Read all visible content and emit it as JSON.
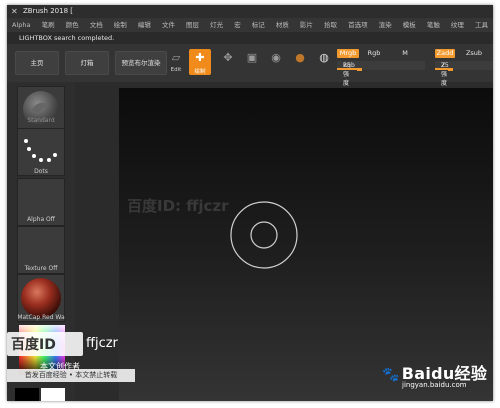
{
  "window": {
    "title": "ZBrush 2018 ["
  },
  "menu": [
    "Alpha",
    "笔刷",
    "颜色",
    "文档",
    "绘制",
    "编辑",
    "文件",
    "图层",
    "灯光",
    "宏",
    "标记",
    "材质",
    "影片",
    "拾取",
    "首选项",
    "渲染",
    "模板",
    "笔触",
    "纹理",
    "工具"
  ],
  "status": {
    "message": "LIGHTBOX search completed."
  },
  "toolbar": {
    "buttons": [
      "主页",
      "灯箱",
      "预览布尔渲染"
    ],
    "draw_label": "绘制",
    "edit_label": "Edit",
    "mrgb": "Mrgb",
    "rgb": "Rgb",
    "m": "M",
    "rgb_intensity_label": "Rgb 强度",
    "rgb_intensity_value": "25",
    "zadd": "Zadd",
    "zsub": "Zsub",
    "z_intensity_label": "Z 强度",
    "z_intensity_value": "25",
    "rgb_intensity_fraction": 0.25,
    "z_intensity_fraction": 0.25
  },
  "sidebar": {
    "materials": [
      "Standard",
      "Dots",
      "Alpha Off",
      "Texture Off",
      "MatCap Red Wa"
    ]
  },
  "watermark": {
    "top": "百度ID: ffjczr",
    "logo_text": "百度ID",
    "logo_user": "ffjczr",
    "sub": "本文创作者",
    "strip": "首发百度经验 • 本文禁止转载",
    "baidu": "Baidu经验",
    "url": "jingyan.baidu.com"
  },
  "colors": {
    "accent": "#f39a2e",
    "canvas_top": "#0c0c0c",
    "canvas_bottom": "#343434"
  }
}
